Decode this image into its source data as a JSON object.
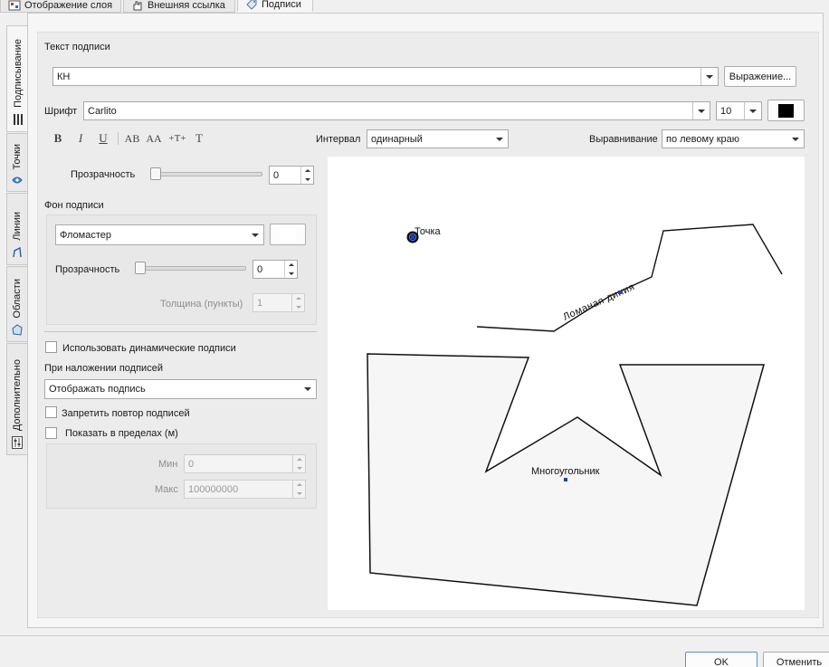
{
  "top_tabs": [
    {
      "label": "Отображение слоя",
      "icon": "layer-display-icon"
    },
    {
      "label": "Внешняя ссылка",
      "icon": "hand-link-icon"
    },
    {
      "label": "Подписи",
      "icon": "label-tag-icon"
    }
  ],
  "side_tabs": [
    {
      "label": "Подписывание",
      "icon": "list-lines-icon"
    },
    {
      "label": "Точки",
      "icon": "point-marker-icon"
    },
    {
      "label": "Линии",
      "icon": "line-shape-icon"
    },
    {
      "label": "Области",
      "icon": "polygon-shape-icon"
    },
    {
      "label": "Дополнительно",
      "icon": "sliders-icon"
    }
  ],
  "label_text": {
    "heading": "Текст подписи",
    "value": "КН",
    "expression_button": "Выражение..."
  },
  "font": {
    "label": "Шрифт",
    "value": "Carlito",
    "size": "10",
    "color": "#000000"
  },
  "format_buttons": [
    "B",
    "I",
    "U",
    "AB",
    "AA",
    "+T+",
    "T"
  ],
  "interval": {
    "label": "Интервал",
    "value": "одинарный"
  },
  "alignment": {
    "label": "Выравнивание",
    "value": "по левому краю"
  },
  "transparency": {
    "label": "Прозрачность",
    "value": "0"
  },
  "background": {
    "heading": "Фон подписи",
    "style": "Фломастер",
    "transparency_label": "Прозрачность",
    "transparency_value": "0",
    "thickness_label": "Толщина (пункты)",
    "thickness_value": "1"
  },
  "dynamic_labels": "Использовать динамические подписи",
  "overlap": {
    "heading": "При наложении подписей",
    "value": "Отображать подпись"
  },
  "no_repeat": "Запретить повтор подписей",
  "show_within": {
    "label": "Показать в пределах (м)",
    "min_label": "Мин",
    "min_value": "0",
    "max_label": "Макс",
    "max_value": "100000000"
  },
  "preview": {
    "point_label": "Точка",
    "line_label": "Ломаная диния",
    "polygon_label": "Многоугольник"
  },
  "footer": {
    "ok": "OK",
    "cancel": "Отменить"
  }
}
